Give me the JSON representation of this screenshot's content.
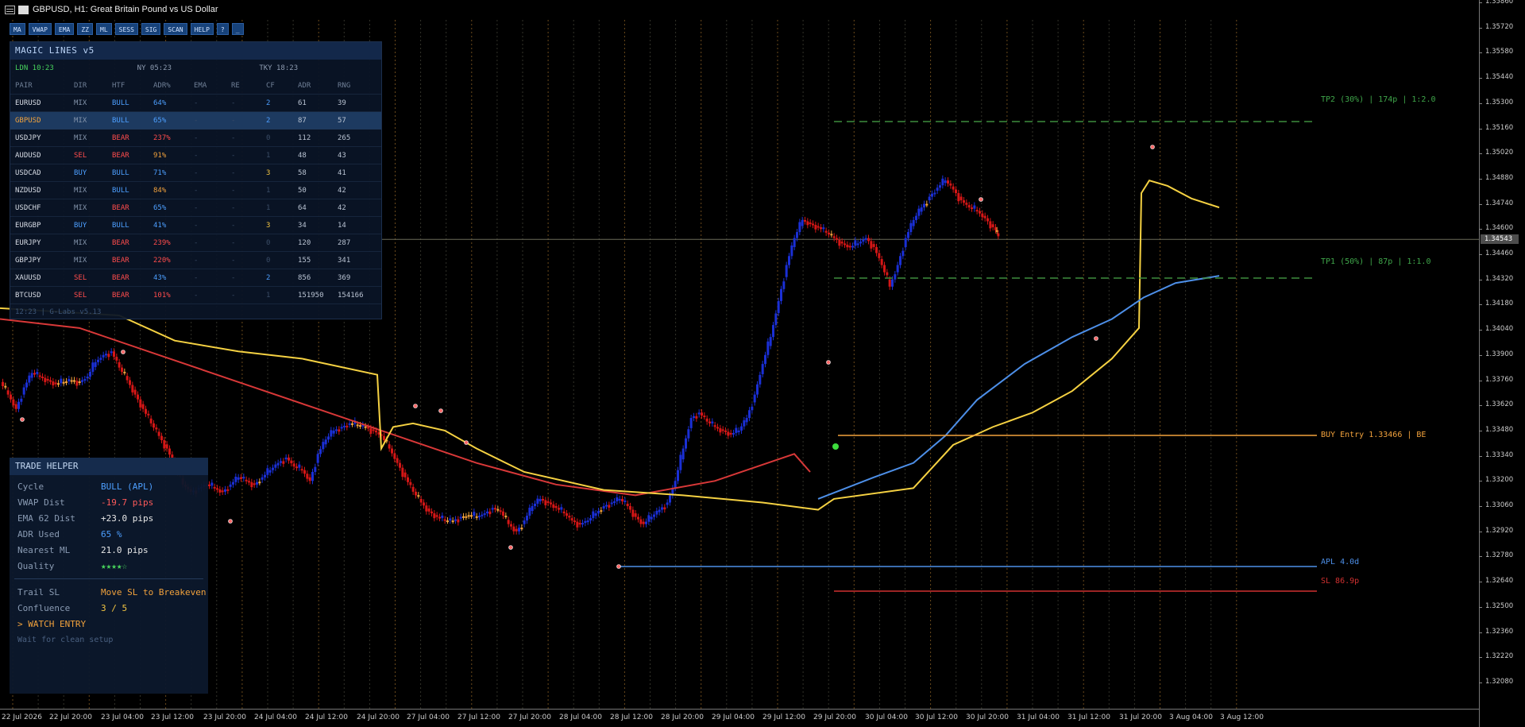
{
  "window": {
    "title": "GBPUSD, H1:  Great Britain Pound vs US Dollar"
  },
  "toolbar": [
    {
      "label": "MA"
    },
    {
      "label": "VWAP"
    },
    {
      "label": "EMA"
    },
    {
      "label": "ZZ"
    },
    {
      "label": "ML"
    },
    {
      "label": "SESS"
    },
    {
      "label": "SIG"
    },
    {
      "label": "SCAN"
    },
    {
      "label": "HELP"
    },
    {
      "label": "?"
    },
    {
      "label": "_"
    }
  ],
  "magic_lines": {
    "title": "MAGIC LINES v5",
    "sessions": [
      {
        "label": "LDN 10:23",
        "color": "#47d35c"
      },
      {
        "label": "NY  05:23",
        "color": "#8d9bb0"
      },
      {
        "label": "TKY 18:23",
        "color": "#8d9bb0"
      }
    ],
    "columns": [
      "PAIR",
      "DIR",
      "HTF",
      "ADR%",
      "EMA",
      "RE",
      "CF",
      "ADR",
      "RNG"
    ],
    "rows": [
      {
        "pair": "EURUSD",
        "dir": "MIX",
        "htf": "BULL",
        "adrp": "64%",
        "ema": "-",
        "re": "-",
        "cf": "2",
        "adr": "61",
        "rng": "39",
        "selected": false
      },
      {
        "pair": "GBPUSD",
        "dir": "MIX",
        "htf": "BULL",
        "adrp": "65%",
        "ema": "-",
        "re": "-",
        "cf": "2",
        "adr": "87",
        "rng": "57",
        "selected": true
      },
      {
        "pair": "USDJPY",
        "dir": "MIX",
        "htf": "BEAR",
        "adrp": "237%",
        "ema": "-",
        "re": "-",
        "cf": "0",
        "adr": "112",
        "rng": "265",
        "selected": false
      },
      {
        "pair": "AUDUSD",
        "dir": "SEL",
        "htf": "BEAR",
        "adrp": "91%",
        "ema": "-",
        "re": "-",
        "cf": "1",
        "adr": "48",
        "rng": "43",
        "selected": false
      },
      {
        "pair": "USDCAD",
        "dir": "BUY",
        "htf": "BULL",
        "adrp": "71%",
        "ema": "-",
        "re": "-",
        "cf": "3",
        "adr": "58",
        "rng": "41",
        "selected": false
      },
      {
        "pair": "NZDUSD",
        "dir": "MIX",
        "htf": "BULL",
        "adrp": "84%",
        "ema": "-",
        "re": "-",
        "cf": "1",
        "adr": "50",
        "rng": "42",
        "selected": false
      },
      {
        "pair": "USDCHF",
        "dir": "MIX",
        "htf": "BEAR",
        "adrp": "65%",
        "ema": "-",
        "re": "-",
        "cf": "1",
        "adr": "64",
        "rng": "42",
        "selected": false
      },
      {
        "pair": "EURGBP",
        "dir": "BUY",
        "htf": "BULL",
        "adrp": "41%",
        "ema": "-",
        "re": "-",
        "cf": "3",
        "adr": "34",
        "rng": "14",
        "selected": false
      },
      {
        "pair": "EURJPY",
        "dir": "MIX",
        "htf": "BEAR",
        "adrp": "239%",
        "ema": "-",
        "re": "-",
        "cf": "0",
        "adr": "120",
        "rng": "287",
        "selected": false
      },
      {
        "pair": "GBPJPY",
        "dir": "MIX",
        "htf": "BEAR",
        "adrp": "220%",
        "ema": "-",
        "re": "-",
        "cf": "0",
        "adr": "155",
        "rng": "341",
        "selected": false
      },
      {
        "pair": "XAUUSD",
        "dir": "SEL",
        "htf": "BEAR",
        "adrp": "43%",
        "ema": "-",
        "re": "-",
        "cf": "2",
        "adr": "856",
        "rng": "369",
        "selected": false
      },
      {
        "pair": "BTCUSD",
        "dir": "SEL",
        "htf": "BEAR",
        "adrp": "101%",
        "ema": "-",
        "re": "-",
        "cf": "1",
        "adr": "151950",
        "rng": "154166",
        "selected": false
      }
    ],
    "footer": "12:23 | G-Labs v5.13"
  },
  "trade_helper": {
    "title": "TRADE HELPER",
    "rows": [
      {
        "label": "Cycle",
        "value": "BULL  (APL)",
        "color": "#4d9fff"
      },
      {
        "label": "VWAP Dist",
        "value": "-19.7 pips",
        "color": "#ff5a5a"
      },
      {
        "label": "EMA 62 Dist",
        "value": "+23.0 pips",
        "color": "#e8e8e8"
      },
      {
        "label": "ADR Used",
        "value": "65 %",
        "color": "#4d9fff"
      },
      {
        "label": "Nearest ML",
        "value": "21.0 pips",
        "color": "#e8e8e8"
      },
      {
        "label": "Quality",
        "value": "★★★★☆",
        "color": "#47d35c"
      }
    ],
    "rows2": [
      {
        "label": "Trail SL",
        "value": "Move SL to Breakeven",
        "color": "#f2a23c"
      },
      {
        "label": "Confluence",
        "value": "3 / 5",
        "color": "#f2c542"
      }
    ],
    "signal": "> WATCH ENTRY",
    "hint": "Wait for clean setup"
  },
  "levels": {
    "tp2": "TP2 (30%) | 174p | 1:2.0",
    "tp1": "TP1 (50%) | 87p | 1:1.0",
    "entry": "BUY Entry 1.33466 | BE",
    "apl": "APL 4.0d",
    "sl": "SL 86.9p"
  },
  "price_axis": {
    "ticks": [
      "1.35720",
      "1.35580",
      "1.35440",
      "1.35300",
      "1.35160",
      "1.35020",
      "1.34880",
      "1.34740",
      "1.34600",
      "1.34460",
      "1.34320",
      "1.34180",
      "1.34040",
      "1.33900",
      "1.33760",
      "1.33620",
      "1.33480",
      "1.33340",
      "1.33200",
      "1.33060",
      "1.32920",
      "1.32780",
      "1.32640",
      "1.32500",
      "1.32360",
      "1.32220",
      "1.32080"
    ],
    "top_tick": "1.35860",
    "current": "1.34543"
  },
  "time_axis": [
    "22 Jul 2026",
    "22 Jul 20:00",
    "23 Jul 04:00",
    "23 Jul 12:00",
    "23 Jul 20:00",
    "24 Jul 04:00",
    "24 Jul 12:00",
    "24 Jul 20:00",
    "27 Jul 04:00",
    "27 Jul 12:00",
    "27 Jul 20:00",
    "28 Jul 04:00",
    "28 Jul 12:00",
    "28 Jul 20:00",
    "29 Jul 04:00",
    "29 Jul 12:00",
    "29 Jul 20:00",
    "30 Jul 04:00",
    "30 Jul 12:00",
    "30 Jul 20:00",
    "31 Jul 04:00",
    "31 Jul 12:00",
    "31 Jul 20:00",
    "3 Aug 04:00",
    "3 Aug 12:00"
  ],
  "colors": {
    "bull_candle": "#1a2fd6",
    "bear_candle": "#d41616",
    "neutral_candle": "#f2a23c",
    "ema_line": "#d83838",
    "vwap_line": "#f5d142",
    "apl_line": "#4d8fe8",
    "entry_line": "#f2a23c",
    "tp_line": "#3e8e3e",
    "sl_line": "#d03030"
  }
}
